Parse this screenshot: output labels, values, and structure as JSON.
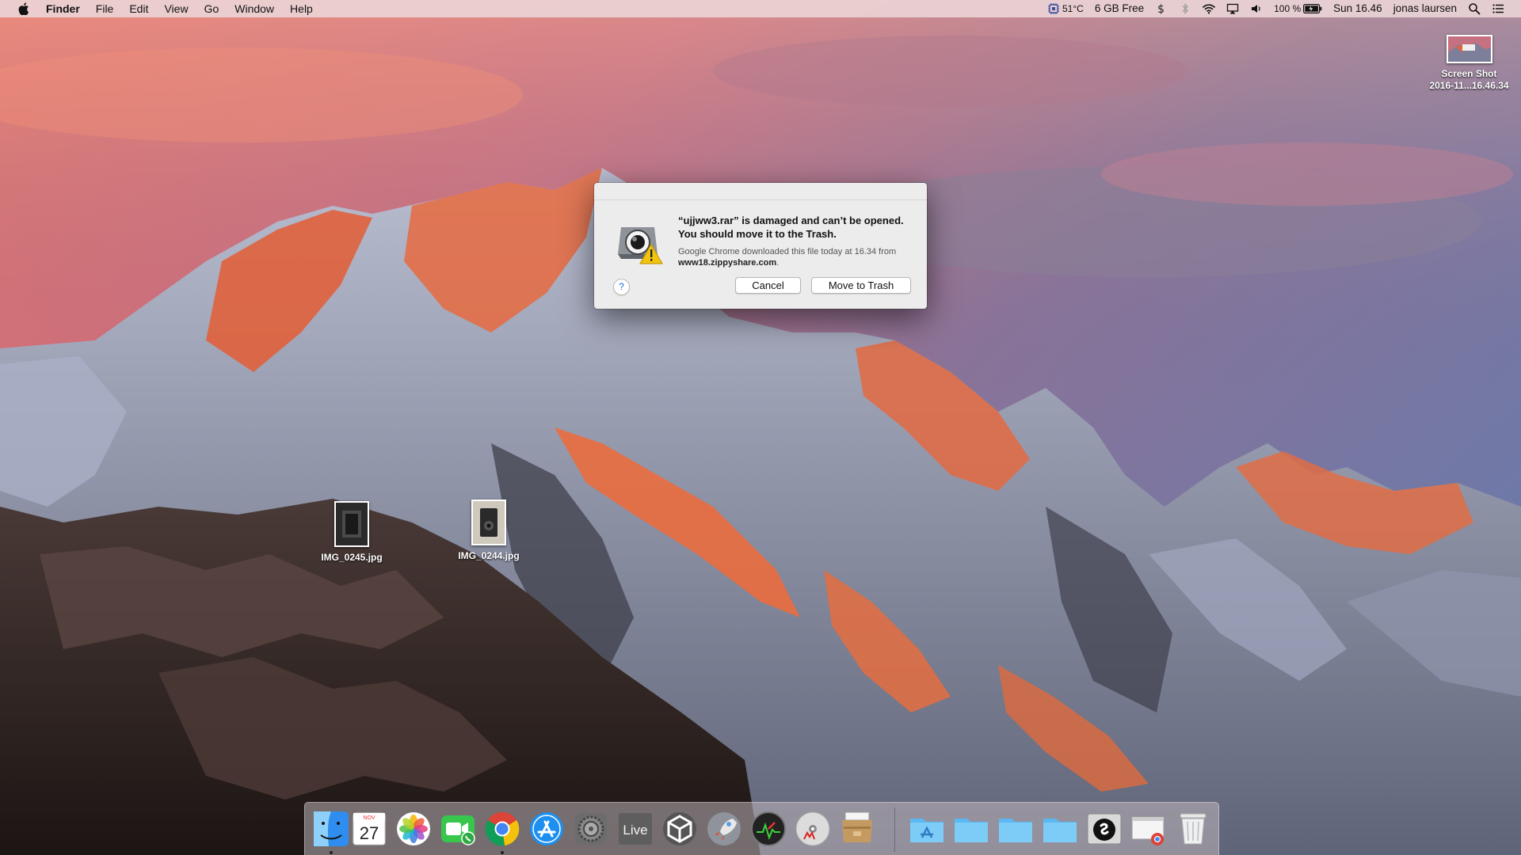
{
  "menubar": {
    "app_name": "Finder",
    "menus": [
      "File",
      "Edit",
      "View",
      "Go",
      "Window",
      "Help"
    ],
    "status": {
      "temperature": "51°C",
      "disk_free": "6 GB Free",
      "battery": "100 %",
      "clock": "Sun 16.46",
      "user": "jonas laursen"
    }
  },
  "desktop": {
    "screenshot_file": {
      "line1": "Screen Shot",
      "line2": "2016-11...16.46.34"
    },
    "files": [
      {
        "name": "IMG_0245.jpg"
      },
      {
        "name": "IMG_0244.jpg"
      }
    ]
  },
  "dialog": {
    "title": "“ujjww3.rar” is damaged and can’t be opened. You should move it to the Trash.",
    "info_prefix": "Google Chrome downloaded this file today at 16.34 from",
    "info_domain": "www18.zippyshare.com",
    "info_suffix": ".",
    "help_label": "?",
    "cancel_label": "Cancel",
    "trash_label": "Move to Trash"
  },
  "dock": {
    "calendar": {
      "month": "NOV",
      "day": "27"
    },
    "live_label": "Live",
    "items": [
      "finder-icon",
      "calendar-icon",
      "photos-icon",
      "facetime-icon",
      "chrome-icon",
      "app-store-icon",
      "system-preferences-icon",
      "ableton-live-icon",
      "unity-icon",
      "launchpad-icon",
      "activity-monitor-icon",
      "max-dvd-icon",
      "archive-utility-icon",
      "applications-folder-icon",
      "folder-icon",
      "folder-icon",
      "folder-icon",
      "shazam-icon",
      "chrome-download-icon",
      "trash-icon"
    ]
  },
  "colors": {
    "menubar_bg": "#ecd6d8",
    "dialog_bg": "#ececec",
    "link_blue": "#1d6fe0"
  }
}
